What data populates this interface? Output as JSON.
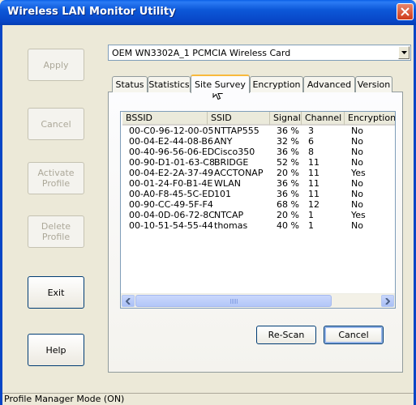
{
  "window": {
    "title": "Wireless LAN Monitor Utility"
  },
  "side_buttons": [
    {
      "name": "apply-button",
      "label": "Apply",
      "enabled": false
    },
    {
      "name": "cancel-button",
      "label": "Cancel",
      "enabled": false
    },
    {
      "name": "activate-profile-button",
      "label": "Activate\nProfile",
      "enabled": false
    },
    {
      "name": "delete-profile-button",
      "label": "Delete\nProfile",
      "enabled": false
    },
    {
      "name": "exit-button",
      "label": "Exit",
      "enabled": true
    },
    {
      "name": "help-button",
      "label": "Help",
      "enabled": true
    }
  ],
  "adapter_select": {
    "value": "OEM WN3302A_1 PCMCIA Wireless Card"
  },
  "tabs": [
    {
      "label": "Status"
    },
    {
      "label": "Statistics"
    },
    {
      "label": "Site Survey",
      "active": true
    },
    {
      "label": "Encryption"
    },
    {
      "label": "Advanced"
    },
    {
      "label": "Version"
    }
  ],
  "table": {
    "columns": [
      "BSSID",
      "SSID",
      "Signal",
      "Channel",
      "Encryption"
    ],
    "rows": [
      [
        "00-C0-96-12-00-05",
        "NTTAP555",
        "36 %",
        "3",
        "No"
      ],
      [
        "00-04-E2-44-08-B6",
        "ANY",
        "32 %",
        "6",
        "No"
      ],
      [
        "00-40-96-56-06-ED",
        "Cisco350",
        "36 %",
        "8",
        "No"
      ],
      [
        "00-90-D1-01-63-C8",
        "BRIDGE",
        "52 %",
        "11",
        "No"
      ],
      [
        "00-04-E2-2A-37-49",
        "ACCTONAP",
        "20 %",
        "11",
        "Yes"
      ],
      [
        "00-01-24-F0-B1-4E",
        "WLAN",
        "36 %",
        "11",
        "No"
      ],
      [
        "00-A0-F8-45-5C-ED",
        "101",
        "36 %",
        "11",
        "No"
      ],
      [
        "00-90-CC-49-5F-F4",
        "",
        "68 %",
        "12",
        "No"
      ],
      [
        "00-04-0D-06-72-8C",
        "NTCAP",
        "20 %",
        "1",
        "Yes"
      ],
      [
        "00-10-51-54-55-44",
        "thomas",
        "40 %",
        "1",
        "No"
      ]
    ]
  },
  "actions": {
    "rescan_label": "Re-Scan",
    "cancel_label": "Cancel"
  },
  "status_bar": {
    "text": "Profile Manager Mode (ON)"
  }
}
